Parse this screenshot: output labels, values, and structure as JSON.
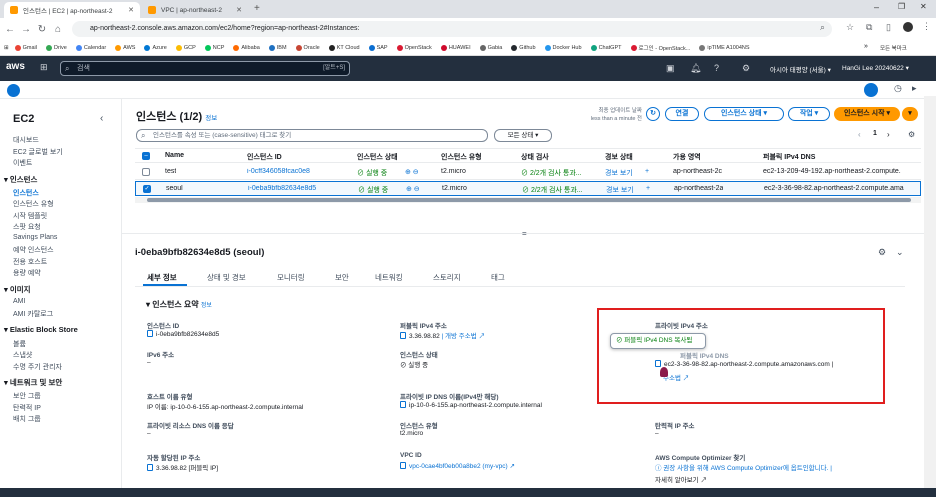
{
  "browser": {
    "tabs": [
      {
        "label": "인스턴스 | EC2 | ap-northeast-2"
      },
      {
        "label": "VPC | ap-northeast-2"
      }
    ],
    "url": "ap-northeast-2.console.aws.amazon.com/ec2/home?region=ap-northeast-2#Instances:",
    "bookmarks": [
      "Gmail",
      "Drive",
      "Calendar",
      "AWS",
      "Azure",
      "GCP",
      "NCP",
      "Alibaba",
      "IBM",
      "Oracle",
      "KT Cloud",
      "SAP",
      "OpenStack",
      "HUAWEI",
      "Gabia",
      "Github",
      "Docker Hub",
      "ChatGPT",
      "로그인 - OpenStack...",
      "ipTIME A1004NS"
    ],
    "all_bookmarks": "모든 북마크"
  },
  "aws": {
    "logo": "aws",
    "search_placeholder": "검색",
    "search_kbd": "[알트+S]",
    "region": "아시아 태평양 (서울) ▾",
    "user": "HanGi Lee 20240622 ▾"
  },
  "sidebar": {
    "title": "EC2",
    "items": [
      {
        "label": "대시보드"
      },
      {
        "label": "EC2 글로벌 보기"
      },
      {
        "label": "이벤트"
      },
      {
        "label": "▾ 인스턴스",
        "section": true
      },
      {
        "label": "인스턴스",
        "active": true
      },
      {
        "label": "인스턴스 유형"
      },
      {
        "label": "시작 템플릿"
      },
      {
        "label": "스팟 요청"
      },
      {
        "label": "Savings Plans"
      },
      {
        "label": "예약 인스턴스"
      },
      {
        "label": "전용 호스트"
      },
      {
        "label": "용량 예약"
      },
      {
        "label": "▾ 이미지",
        "section": true
      },
      {
        "label": "AMI"
      },
      {
        "label": "AMI 카탈로그"
      },
      {
        "label": "▾ Elastic Block Store",
        "section": true
      },
      {
        "label": "볼륨"
      },
      {
        "label": "스냅샷"
      },
      {
        "label": "수명 주기 관리자"
      },
      {
        "label": "▾ 네트워크 및 보안",
        "section": true
      },
      {
        "label": "보안 그룹"
      },
      {
        "label": "탄력적 IP"
      },
      {
        "label": "배치 그룹"
      }
    ]
  },
  "instances": {
    "title": "인스턴스 (1/2)",
    "info": "정보",
    "last_updated": "최종 업데이트 날짜",
    "last_updated_value": "less than a minute 전",
    "buttons": {
      "connect": "연결",
      "state": "인스턴스 상태 ▾",
      "actions": "작업 ▾",
      "launch": "인스턴스 시작 ▾"
    },
    "filter_placeholder": "인스턴스를 속성 또는 (case-sensitive) 태그로 찾기",
    "state_filter": "모든 상태 ▾",
    "page": "1",
    "columns": [
      "Name",
      "인스턴스 ID",
      "인스턴스 상태",
      "인스턴스 유형",
      "상태 검사",
      "경보 상태",
      "가용 영역",
      "퍼블릭 IPv4 DNS"
    ],
    "rows": [
      {
        "name": "test",
        "id": "i-0cff346058fcac0e8",
        "state": "⊘ 실행 중",
        "type": "t2.micro",
        "check": "⊘ 2/2개 검사 통과...",
        "alarm": "경보 보기",
        "az": "ap-northeast-2c",
        "dns": "ec2-13-209-49-192.ap-northeast-2.compute.",
        "selected": false
      },
      {
        "name": "seoul",
        "id": "i-0eba9bfb82634e8d5",
        "state": "⊘ 실행 중",
        "type": "t2.micro",
        "check": "⊘ 2/2개 검사 통과...",
        "alarm": "경보 보기",
        "az": "ap-northeast-2a",
        "dns": "ec2-3-36-98-82.ap-northeast-2.compute.ama",
        "selected": true
      }
    ]
  },
  "detail": {
    "title": "i-0eba9bfb82634e8d5 (seoul)",
    "tabs": [
      "세부 정보",
      "상태 및 경보",
      "모니터링",
      "보안",
      "네트워킹",
      "스토리지",
      "태그"
    ],
    "summary_title": "▾ 인스턴스 요약",
    "summary_info": "정보",
    "fields": {
      "instance_id_label": "인스턴스 ID",
      "instance_id": "i-0eba9bfb82634e8d5",
      "ipv6_label": "IPv6 주소",
      "ipv6": "–",
      "hostname_type_label": "호스트 이름 유형",
      "hostname_type": "IP 이름: ip-10-0-6-155.ap-northeast-2.compute.internal",
      "private_dns_name_label": "프라이빗 리소스 DNS 이름 응답",
      "private_dns_name": "–",
      "auto_ip_label": "자동 할당된 IP 주소",
      "auto_ip": "3.36.98.82 [퍼블릭 IP]",
      "public_ip_label": "퍼블릭 IPv4 주소",
      "public_ip": "3.36.98.82",
      "open_addr": "| 개방 주소법",
      "state_label": "인스턴스 상태",
      "state": "⊘ 실행 중",
      "private_dns_label": "프라이빗 IP DNS 이름(IPv4만 해당)",
      "private_dns": "ip-10-0-6-155.ap-northeast-2.compute.internal",
      "type_label": "인스턴스 유형",
      "type": "t2.micro",
      "vpc_label": "VPC ID",
      "vpc": "vpc-0cae4bf0eb00a8be2 (my-vpc)",
      "private_ip_label": "프라이빗 IPv4 주소",
      "public_dns_label": "퍼블릭 IPv4 DNS",
      "public_dns": "ec2-3-36-98-82.ap-northeast-2.compute.amazonaws.com |",
      "open_addr2": "주소법",
      "elastic_ip_label": "탄력적 IP 주소",
      "elastic_ip": "–",
      "optimizer_label": "AWS Compute Optimizer 찾기",
      "optimizer": "ⓘ 권장 사항을 위해 AWS Compute Optimizer에 옵트인합니다. |",
      "optimizer_more": "자세히 알아보기 ↗"
    },
    "tooltip": "⊘ 퍼블릭 IPv4 DNS 복사됨"
  }
}
